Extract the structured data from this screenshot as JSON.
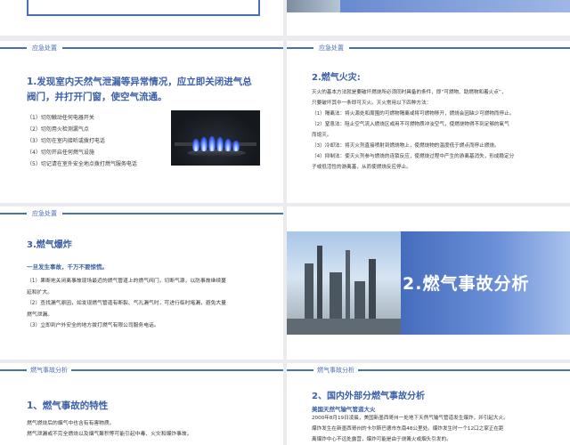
{
  "colors": {
    "accent": "#4a6fb5",
    "title_blue": "#3b5fa8",
    "text": "#333333"
  },
  "tag_emergency": "应急处置",
  "tag_analysis": "燃气事故分析",
  "slide3": {
    "title_line1": "1.发现室内天然气泄漏等异常情况，应立即关闭进气总",
    "title_line2": "阀门，并打开门窗，使空气流通。",
    "items": [
      "（1）切勿触动任何电器开关",
      "（2）切勿用火检测漏气点",
      "（3）切勿在室内接听或拨打电话",
      "（4）切勿开启任何燃气设施",
      "（5）切记请在室外安全地点拨打燃气服务电话"
    ],
    "photo_icon": "gas-stove-flame-photo"
  },
  "slide4": {
    "title": "2.燃气火灾:",
    "lines": [
      "灭火的基本方法就是要破坏燃烧所必须同时具备的条件，即“可燃物、助燃物和着火点”，",
      "只要破坏其中一条即可灭火。灭火常用以下四种方法：",
      "（1）隔离法：将火源处和周围的可燃物隔离或将可燃物移开，燃烧会因缺少可燃物而停止。",
      "（2）窒息法：阻止空气流入燃烧区或用不可燃物质冲淡空气，使燃烧物得不到足够的氧气",
      "而熄灭。",
      "（3）冷却法：将灭火剂直接喷射到燃烧物上，使燃烧物的温度低于燃点而停止燃烧。",
      "（4）抑制法：使灭火剂参与燃烧的连锁反应，使燃烧过程中产生的游离基消失，形成稳定分",
      "子或低活性的游离基，从而使燃烧反应停止。"
    ]
  },
  "slide5": {
    "title": "3.燃气爆炸",
    "subtitle": "一旦发生事故，千万不要惊慌。",
    "lines": [
      "（1）果断地关闭离事故现场最近的燃气管道上的燃气阀门，切断气源，以防事故继续蔓",
      "延和扩大。",
      "（2）查找漏气原因，如发现燃气管道有断裂、气孔漏气时，可进行临时堵漏，避免大量",
      "燃气泄漏。",
      "（3）立即到户外安全的地方拨打燃气有限公司服务电话。"
    ]
  },
  "slide6": {
    "title": "2.燃气事故分析",
    "photo_icon": "industrial-plant-photo"
  },
  "slide7": {
    "title": "1、燃气事故的特性",
    "lines": [
      "燃气燃烧后的烟气中也含有有害物质。",
      "燃气泄漏或不完全燃烧以及烟气聚积等可能引起中毒、火灾和爆炸事故。"
    ]
  },
  "slide8": {
    "title": "2、国内外部分燃气事故分析",
    "subtitle": "美国天然气输气管道大火",
    "lines": [
      "2000年8月19日凌晨，美国新墨西哥州一处地下天然气输气管道发生爆炸，并引起大火。",
      "爆炸发生在新墨西哥州的卡尔斯巴德市东南48公里处。爆炸发生时一个12口之家正在距",
      "离爆炸中心不远处露营，爆炸可能是由于烧篝火或烟头引发的。"
    ]
  }
}
